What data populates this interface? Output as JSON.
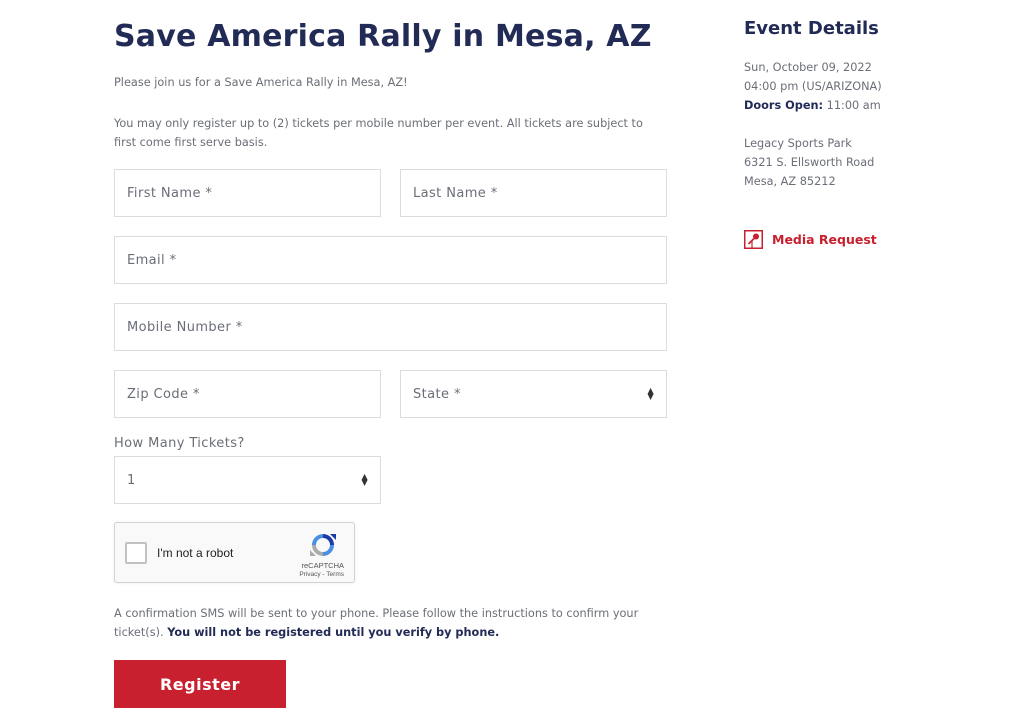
{
  "event": {
    "title": "Save America Rally in Mesa, AZ",
    "intro": "Please join us for a Save America Rally in Mesa, AZ!",
    "notice": "You may only register up to (2) tickets per mobile number per event. All tickets are subject to first come first serve basis."
  },
  "form": {
    "first_name": {
      "placeholder": "First Name *",
      "value": ""
    },
    "last_name": {
      "placeholder": "Last Name *",
      "value": ""
    },
    "email": {
      "placeholder": "Email *",
      "value": ""
    },
    "mobile": {
      "placeholder": "Mobile Number *",
      "value": ""
    },
    "zip": {
      "placeholder": "Zip Code *",
      "value": ""
    },
    "state": {
      "selected": "State *"
    },
    "tickets": {
      "label": "How Many Tickets?",
      "selected": "1"
    },
    "captcha": {
      "label": "I'm not a robot",
      "brand": "reCAPTCHA",
      "privacy": "Privacy",
      "separator": " - ",
      "terms": "Terms",
      "checked": false
    },
    "confirm_text": "A confirmation SMS will be sent to your phone. Please follow the instructions to confirm your ticket(s).",
    "confirm_bold": "You will not be registered until you verify by phone.",
    "register_label": "Register"
  },
  "details": {
    "title": "Event Details",
    "date": "Sun, October 09, 2022",
    "time": "04:00 pm (US/ARIZONA)",
    "doors_label": "Doors Open:",
    "doors_time": "11:00 am",
    "venue": "Legacy Sports Park",
    "street": "6321 S. Ellsworth Road",
    "city": "Mesa, AZ 85212",
    "media_label": "Media Request",
    "media_icon": "microphone-icon"
  },
  "colors": {
    "heading": "#222b55",
    "accent": "#c8202f",
    "body_text": "#6b6e78",
    "border": "#dcdcdc"
  }
}
